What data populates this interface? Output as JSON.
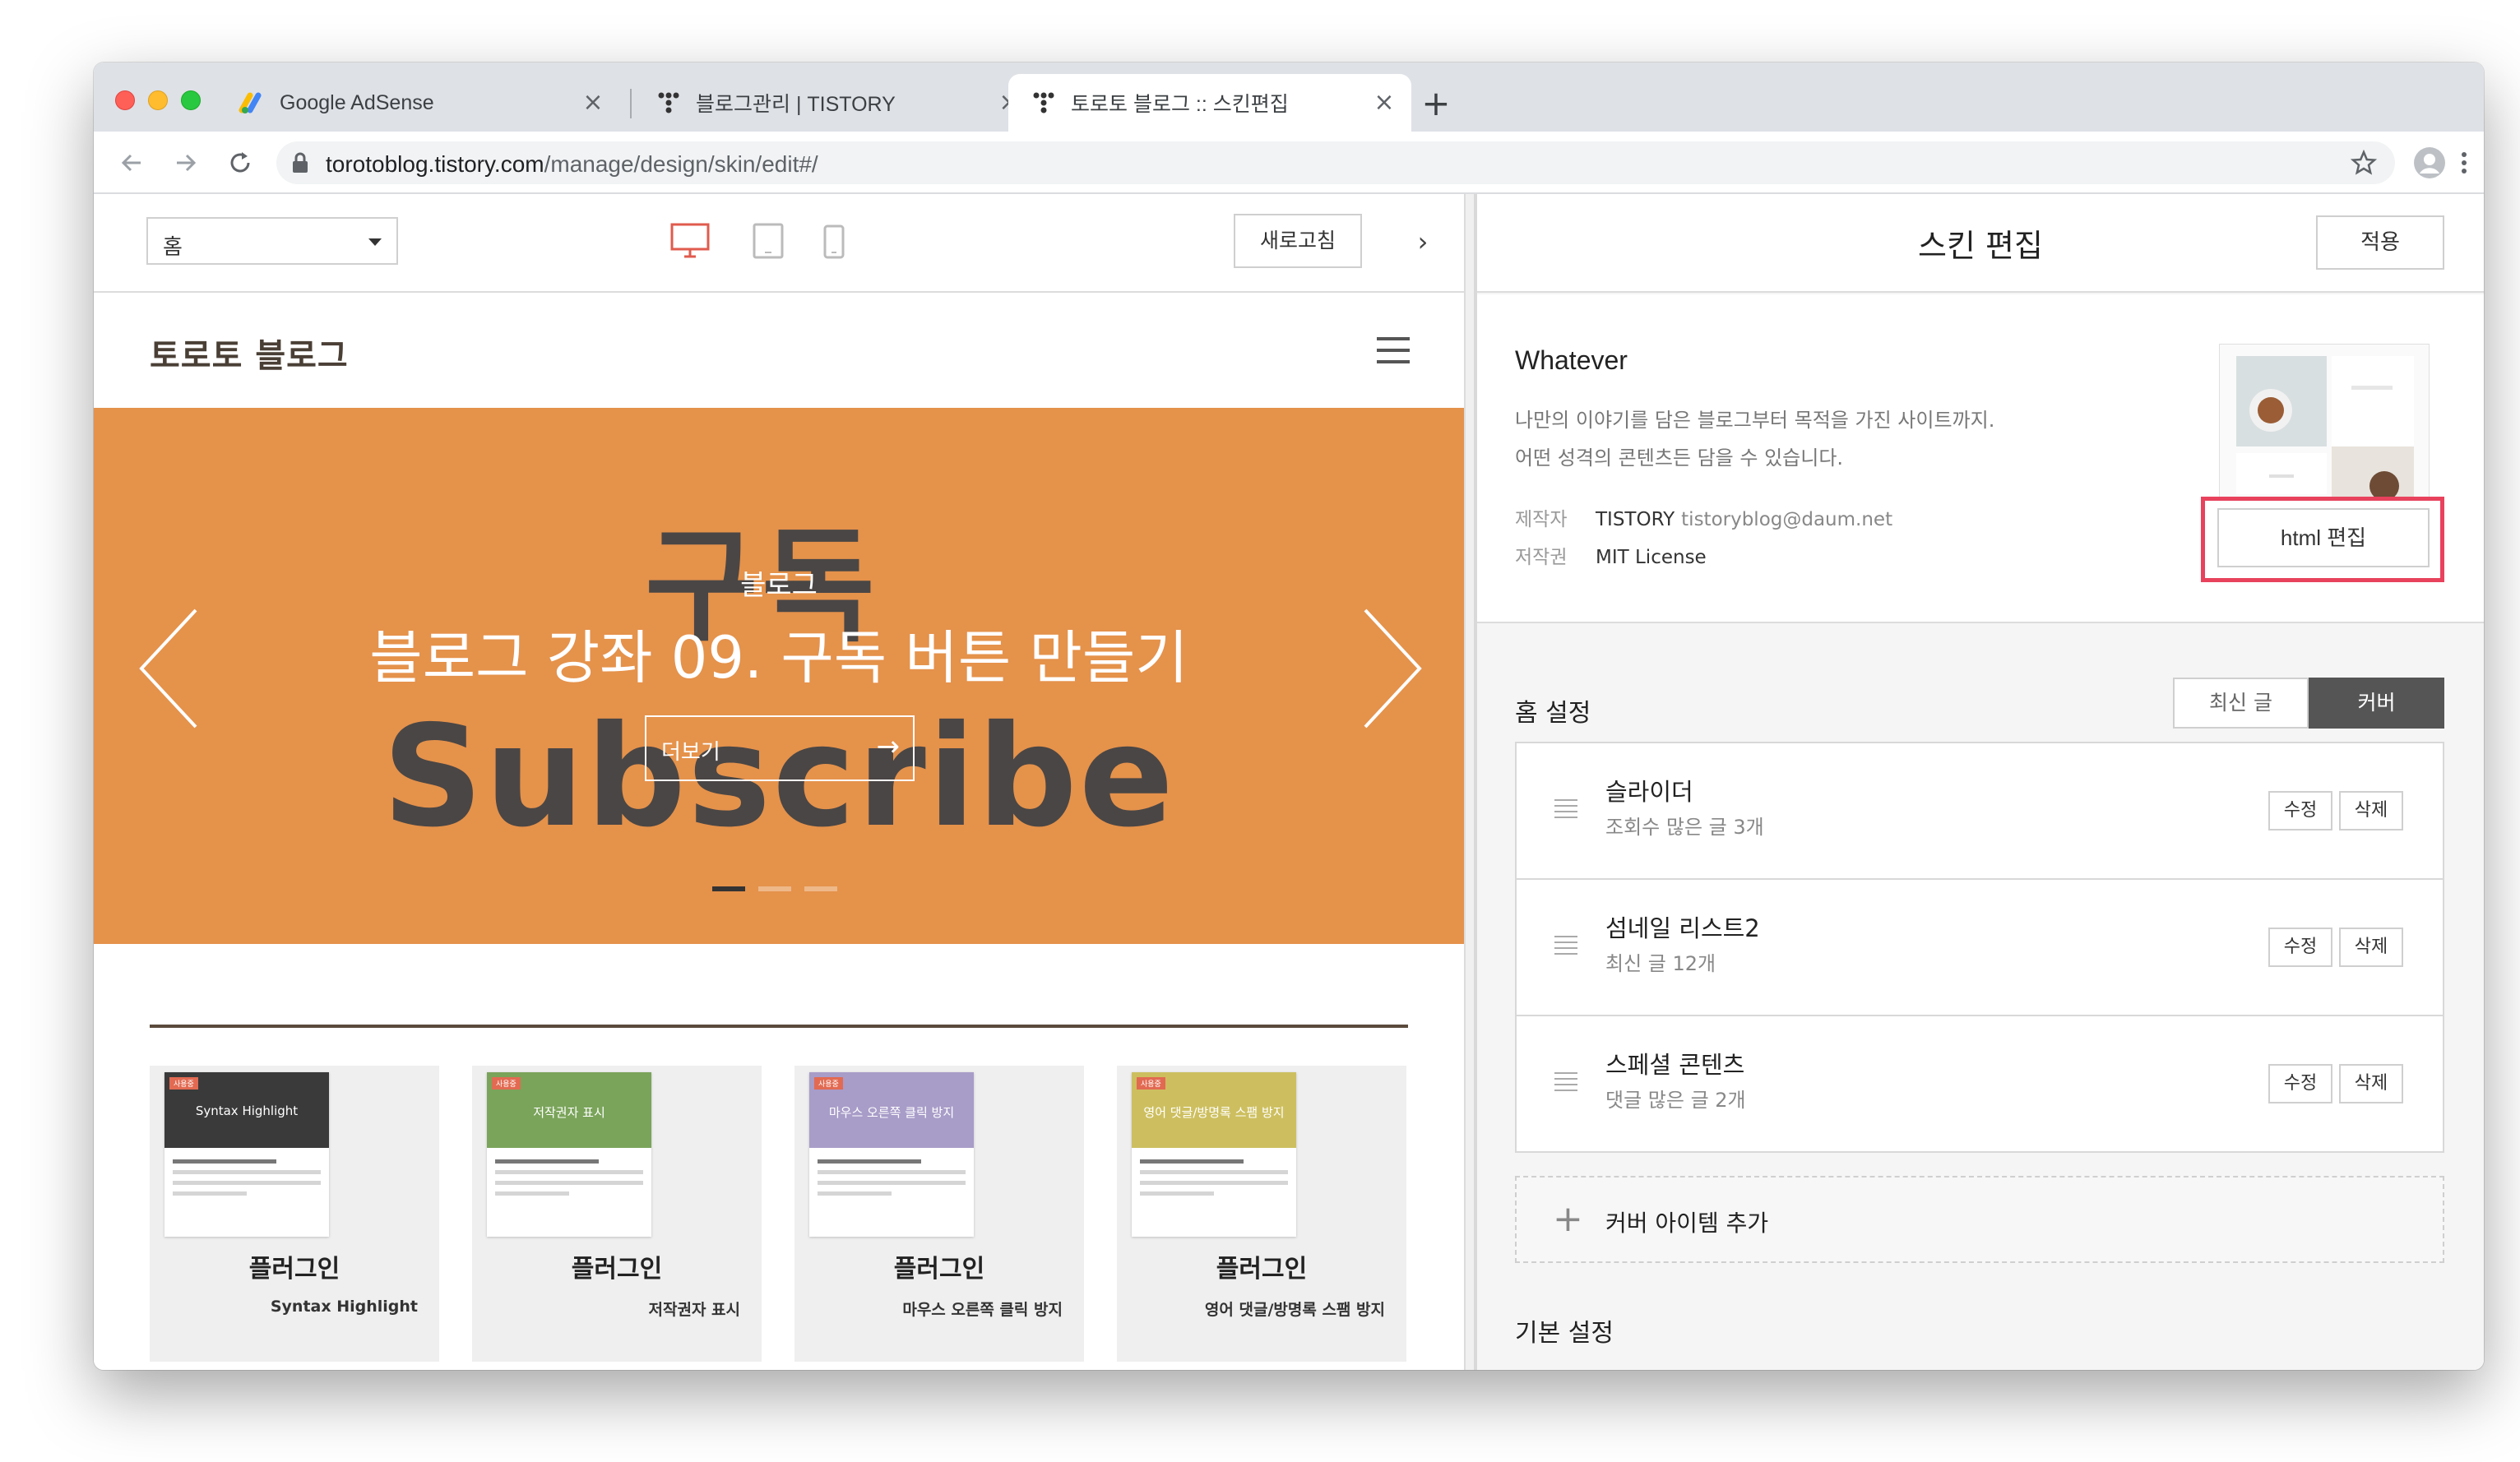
{
  "browser": {
    "tabs": [
      {
        "title": "Google AdSense",
        "icon": "adsense-icon"
      },
      {
        "title": "블로그관리 | TISTORY",
        "icon": "tistory-icon"
      },
      {
        "title": "토로토 블로그 :: 스킨편집",
        "icon": "tistory-icon",
        "active": true
      }
    ],
    "url_host": "torotoblog.tistory.com",
    "url_path": "/manage/design/skin/edit#/"
  },
  "preview_toolbar": {
    "page_select": "홈",
    "refresh_label": "새로고침"
  },
  "blog": {
    "title": "토로토 블로그",
    "hero": {
      "category": "블로그",
      "headline": "블로그 강좌 09. 구독 버튼 만들기",
      "bg_text_top": "구독",
      "bg_text_bottom": "Subscribe",
      "more_label": "더보기",
      "bg_color": "#e5924b"
    },
    "cards": [
      {
        "thumb_title": "Syntax Highlight",
        "thumb_color": "#3a3a3a",
        "tag": "사용중",
        "name": "플러그인",
        "sub": "Syntax Highlight"
      },
      {
        "thumb_title": "저작권자 표시",
        "thumb_color": "#7aa45a",
        "tag": "사용중",
        "name": "플러그인",
        "sub": "저작권자 표시"
      },
      {
        "thumb_title": "마우스 오른쪽 클릭 방지",
        "thumb_color": "#a89cc8",
        "tag": "사용중",
        "name": "플러그인",
        "sub": "마우스 오른쪽 클릭 방지"
      },
      {
        "thumb_title": "영어 댓글/방명록 스팸 방지",
        "thumb_color": "#cdbf5f",
        "tag": "사용중",
        "name": "플러그인",
        "sub": "영어 댓글/방명록 스팸 방지"
      }
    ]
  },
  "panel": {
    "title": "스킨 편집",
    "apply_label": "적용",
    "skin": {
      "name": "Whatever",
      "desc_line1": "나만의 이야기를 담은 블로그부터 목적을 가진 사이트까지.",
      "desc_line2": "어떤 성격의 콘텐츠든 담을 수 있습니다.",
      "maker_key": "제작자",
      "maker": "TISTORY",
      "maker_email": "tistoryblog@daum.net",
      "license_key": "저작권",
      "license": "MIT License",
      "html_edit_label": "html 편집"
    },
    "home_settings": {
      "title": "홈 설정",
      "mode_recent": "최신 글",
      "mode_cover": "커버",
      "items": [
        {
          "name": "슬라이더",
          "sub": "조회수 많은 글 3개"
        },
        {
          "name": "섬네일 리스트2",
          "sub": "최신 글 12개"
        },
        {
          "name": "스페셜 콘텐츠",
          "sub": "댓글 많은 글 2개"
        }
      ],
      "edit_label": "수정",
      "delete_label": "삭제",
      "add_item_label": "커버 아이템 추가"
    },
    "basic_settings_title": "기본 설정"
  }
}
